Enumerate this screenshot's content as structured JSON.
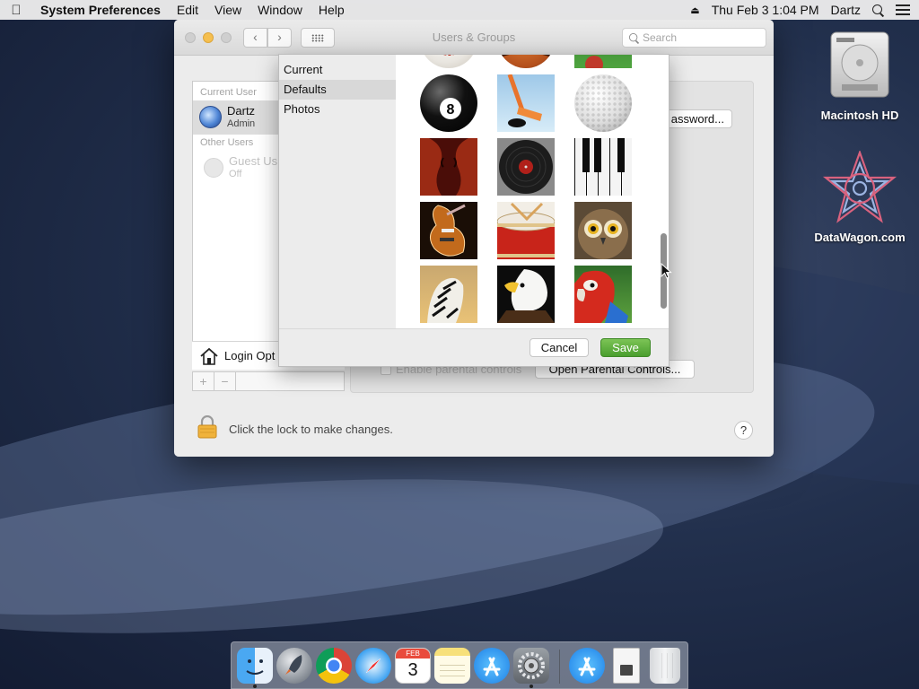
{
  "menubar": {
    "app_name": "System Preferences",
    "menus": [
      "Edit",
      "View",
      "Window",
      "Help"
    ],
    "datetime": "Thu Feb 3  1:04 PM",
    "user": "Dartz"
  },
  "window": {
    "title": "Users & Groups",
    "search_placeholder": "Search"
  },
  "users": {
    "current_header": "Current User",
    "current": {
      "name": "Dartz",
      "role": "Admin"
    },
    "other_header": "Other Users",
    "guest": {
      "name": "Guest Us",
      "status": "Off"
    },
    "login_options": "Login Opt"
  },
  "pane": {
    "password_button": "assword...",
    "parental_label": "Enable parental controls",
    "parental_button": "Open Parental Controls...",
    "lock_text": "Click the lock to make changes.",
    "help": "?"
  },
  "sheet": {
    "sources": [
      "Current",
      "Defaults",
      "Photos"
    ],
    "selected_source": "Defaults",
    "pictures": [
      "baseball",
      "basketball",
      "soccer-field",
      "8-ball",
      "hockey-stick",
      "golf-ball",
      "violin",
      "record",
      "piano-keys",
      "guitar",
      "drum",
      "owl",
      "zebra",
      "eagle",
      "parrot"
    ],
    "eight_ball_number": "8",
    "scroll_position": 0.8,
    "cancel_label": "Cancel",
    "save_label": "Save"
  },
  "desktop": {
    "icons": [
      {
        "label": "Macintosh HD",
        "icon": "hard-drive-icon"
      },
      {
        "label": "DataWagon.com",
        "icon": "mandala-icon"
      }
    ]
  },
  "dock": {
    "apps": [
      "finder-icon",
      "launchpad-icon",
      "chrome-icon",
      "safari-icon",
      "calendar-icon",
      "notes-icon",
      "app-store-icon",
      "system-preferences-icon",
      "app-store-downloads-icon",
      "document-icon",
      "trash-icon"
    ],
    "calendar_month": "FEB",
    "calendar_day": "3"
  },
  "colors": {
    "save_button": "#4a9e2e",
    "minimize_light": "#f5bf4f",
    "selection": "#d8d8d8"
  }
}
